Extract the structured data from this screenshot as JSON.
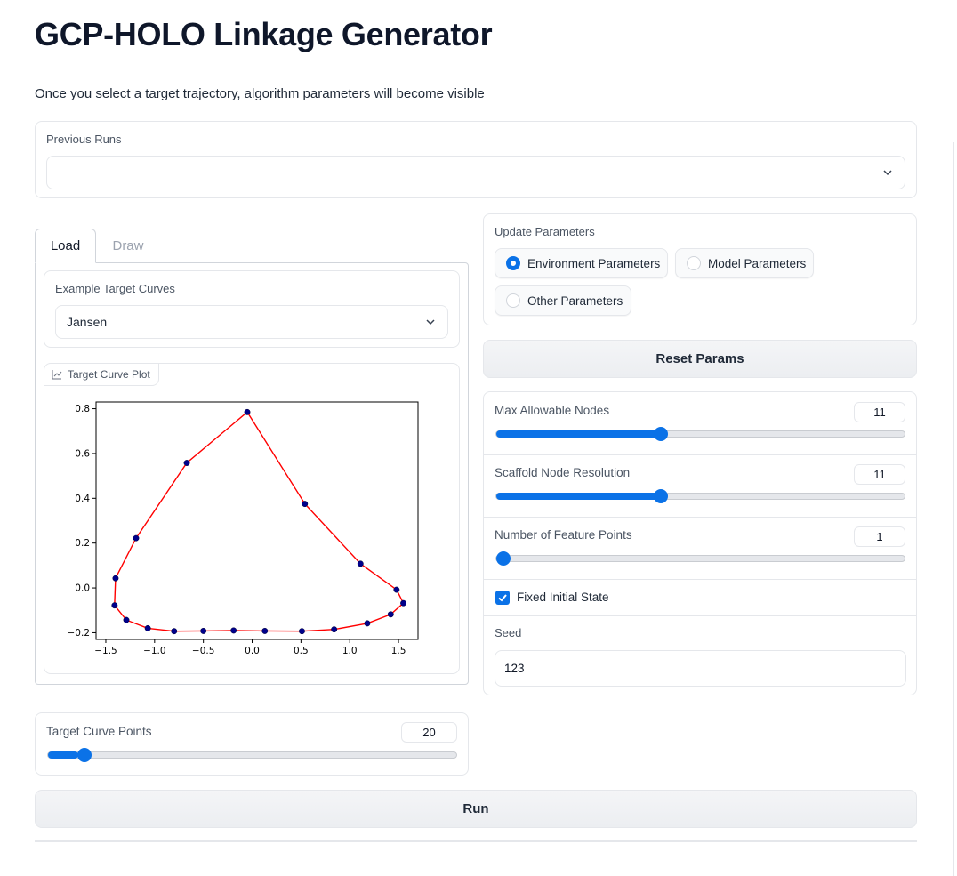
{
  "header": {
    "title": "GCP-HOLO Linkage Generator",
    "subtitle": "Once you select a target trajectory, algorithm parameters will become visible"
  },
  "previous_runs": {
    "label": "Previous Runs",
    "value": ""
  },
  "tabs": [
    {
      "label": "Load",
      "active": true
    },
    {
      "label": "Draw",
      "active": false
    }
  ],
  "example_curves": {
    "label": "Example Target Curves",
    "value": "Jansen"
  },
  "plot": {
    "label": "Target Curve Plot",
    "icon": "chart-icon"
  },
  "chart_data": {
    "type": "line",
    "title": "",
    "xlabel": "",
    "ylabel": "",
    "xlim": [
      -1.6,
      1.7
    ],
    "ylim": [
      -0.23,
      0.83
    ],
    "xticks": [
      -1.5,
      -1.0,
      -0.5,
      0.0,
      0.5,
      1.0,
      1.5
    ],
    "xtick_labels": [
      "−1.5",
      "−1.0",
      "−0.5",
      "0.0",
      "0.5",
      "1.0",
      "1.5"
    ],
    "yticks": [
      -0.2,
      0.0,
      0.2,
      0.4,
      0.6,
      0.8
    ],
    "ytick_labels": [
      "−0.2",
      "0.0",
      "0.2",
      "0.4",
      "0.6",
      "0.8"
    ],
    "grid": false,
    "line_color": "#ff0000",
    "marker_color": "#00008b",
    "closed": true,
    "points": [
      [
        -0.05,
        0.785
      ],
      [
        0.54,
        0.375
      ],
      [
        1.11,
        0.108
      ],
      [
        1.48,
        -0.008
      ],
      [
        1.55,
        -0.068
      ],
      [
        1.42,
        -0.118
      ],
      [
        1.18,
        -0.158
      ],
      [
        0.84,
        -0.185
      ],
      [
        0.51,
        -0.193
      ],
      [
        0.13,
        -0.192
      ],
      [
        -0.19,
        -0.19
      ],
      [
        -0.5,
        -0.192
      ],
      [
        -0.8,
        -0.193
      ],
      [
        -1.07,
        -0.18
      ],
      [
        -1.29,
        -0.143
      ],
      [
        -1.41,
        -0.078
      ],
      [
        -1.4,
        0.043
      ],
      [
        -1.19,
        0.222
      ],
      [
        -0.67,
        0.558
      ]
    ]
  },
  "target_points": {
    "label": "Target Curve Points",
    "value": 20,
    "fraction": 0.075
  },
  "update_params": {
    "label": "Update Parameters",
    "options": [
      {
        "label": "Environment Parameters",
        "checked": true
      },
      {
        "label": "Model Parameters",
        "checked": false
      },
      {
        "label": "Other Parameters",
        "checked": false
      }
    ]
  },
  "reset_button": "Reset Params",
  "sliders": [
    {
      "label": "Max Allowable Nodes",
      "value": 11,
      "fraction": 0.4
    },
    {
      "label": "Scaffold Node Resolution",
      "value": 11,
      "fraction": 0.4
    },
    {
      "label": "Number of Feature Points",
      "value": 1,
      "fraction": 0.0
    }
  ],
  "fixed_initial_state": {
    "label": "Fixed Initial State",
    "checked": true
  },
  "seed": {
    "label": "Seed",
    "value": "123"
  },
  "run_button": "Run",
  "colors": {
    "accent": "#0b72e7",
    "border": "#e5e7eb"
  }
}
